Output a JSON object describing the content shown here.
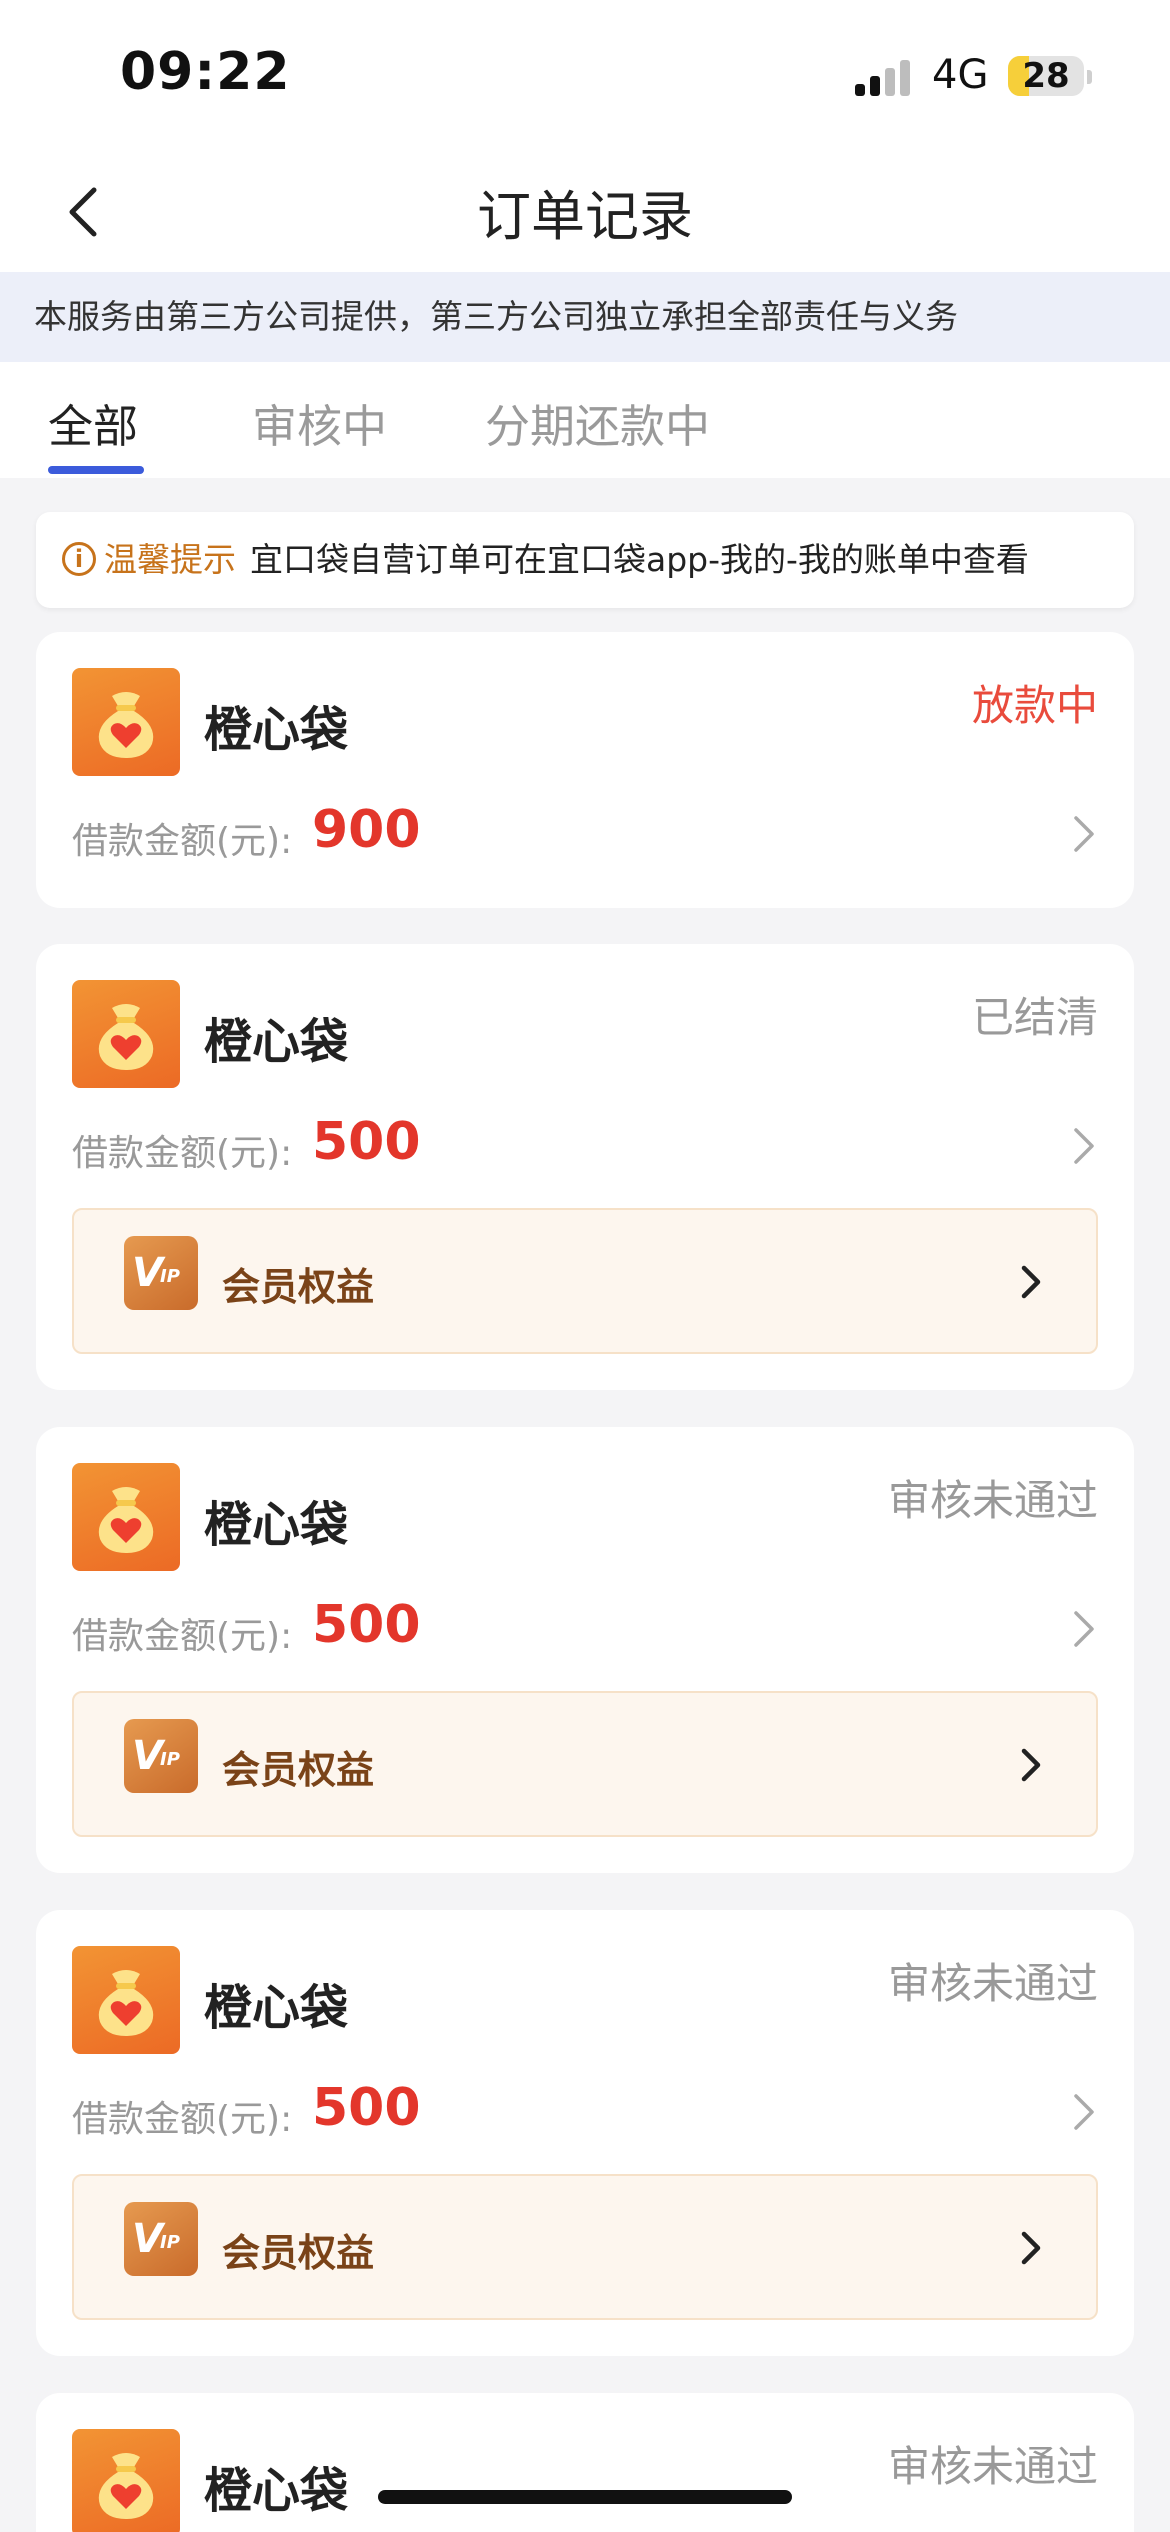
{
  "status_bar": {
    "time": "09:22",
    "network": "4G",
    "battery": "28",
    "battery_level": 0.28
  },
  "nav": {
    "title": "订单记录"
  },
  "notice": {
    "text": "本服务由第三方公司提供，第三方公司独立承担全部责任与义务"
  },
  "tabs": [
    {
      "label": "全部",
      "active": true
    },
    {
      "label": "审核中",
      "active": false
    },
    {
      "label": "分期还款中",
      "active": false
    }
  ],
  "tip": {
    "label": "温馨提示",
    "text": "宜口袋自营订单可在宜口袋app-我的-我的账单中查看"
  },
  "orders": [
    {
      "name": "橙心袋",
      "status": "放款中",
      "status_color": "#e94b3c",
      "amount_label": "借款金额(元):",
      "amount": "900",
      "has_vip": false
    },
    {
      "name": "橙心袋",
      "status": "已结清",
      "status_color": "#999999",
      "amount_label": "借款金额(元):",
      "amount": "500",
      "has_vip": true,
      "vip_label": "会员权益"
    },
    {
      "name": "橙心袋",
      "status": "审核未通过",
      "status_color": "#999999",
      "amount_label": "借款金额(元):",
      "amount": "500",
      "has_vip": true,
      "vip_label": "会员权益"
    },
    {
      "name": "橙心袋",
      "status": "审核未通过",
      "status_color": "#999999",
      "amount_label": "借款金额(元):",
      "amount": "500",
      "has_vip": true,
      "vip_label": "会员权益"
    },
    {
      "name": "橙心袋",
      "status": "审核未通过",
      "status_color": "#999999"
    }
  ],
  "colors": {
    "accent_blue": "#3b5bdb",
    "amount_red": "#e3362b",
    "brand_orange": "#ec6a25"
  }
}
